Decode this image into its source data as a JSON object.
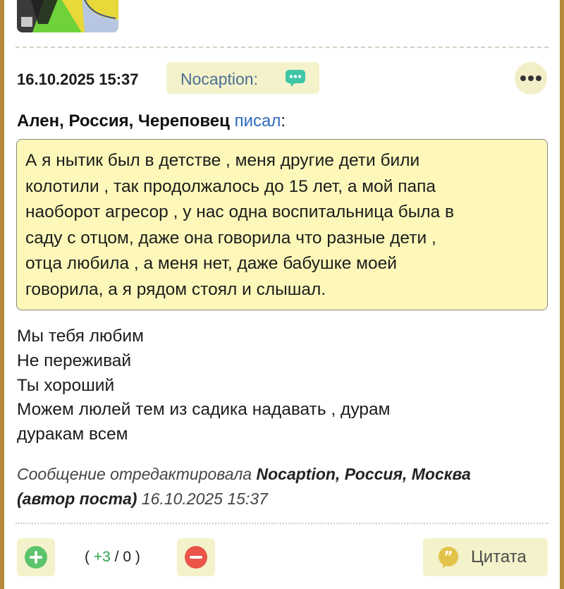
{
  "post": {
    "date": "16.10.2025 15:37",
    "author": "Nocaption:",
    "quote": {
      "author": "Ален, Россия, Череповец",
      "wrote": "писал",
      "colon": ":",
      "lines": [
        "А я нытик был в детстве , меня другие дети били",
        "колотили , так продолжалось до 15 лет, а мой папа",
        "наоборот агресор , у нас одна воспитальница была в",
        "саду с отцом, даже она говорила что разные дети ,",
        "отца любила , а меня нет, даже бабушке моей",
        "говорила, а я рядом стоял и слышал."
      ]
    },
    "body_lines": [
      "Мы тебя любим",
      "Не переживай",
      "Ты хороший",
      "Можем люлей тем из садика надавать , дурам",
      "дуракам всем"
    ],
    "edited": {
      "prefix": "Сообщение отредактировала",
      "editor": "Nocaption, Россия, Москва",
      "role": "(автор поста)",
      "date": "16.10.2025 15:37"
    },
    "votes": {
      "open": "(",
      "plus": "+3",
      "sep": " / ",
      "minus": "0",
      "close": ")"
    },
    "quote_button": "Цитата"
  },
  "colors": {
    "page_border": "#b58a3a",
    "pill_bg": "#f4f2cb",
    "quote_bg": "#fdf8b9",
    "link": "#2f6bbd",
    "plus_green": "#5cc46a",
    "minus_red": "#ea5449"
  },
  "icons": [
    "avatar-image",
    "chat-bubble-icon",
    "more-dots-icon",
    "plus-circle-icon",
    "minus-circle-icon",
    "quote-icon"
  ]
}
